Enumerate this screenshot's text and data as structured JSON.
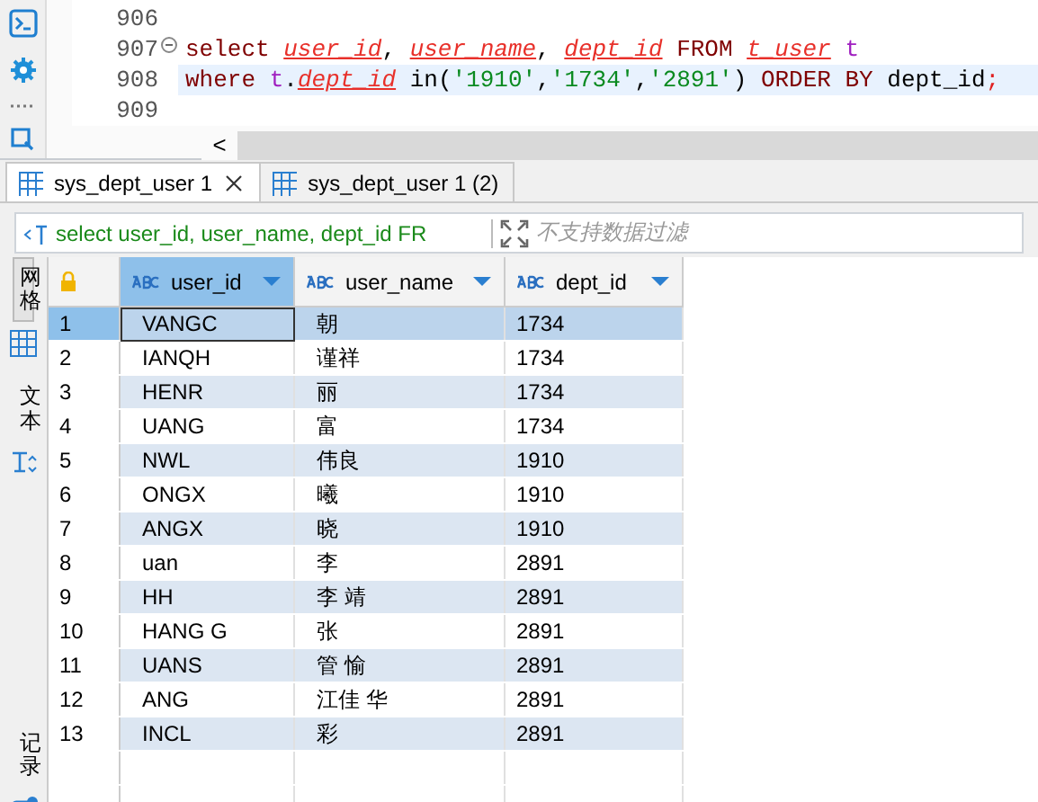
{
  "editor": {
    "lines": [
      {
        "number": "906",
        "current": false,
        "foldable": false
      },
      {
        "number": "907",
        "current": false,
        "foldable": true,
        "tokens": [
          {
            "text": "select ",
            "kind": "keyword"
          },
          {
            "text": "user_id",
            "kind": "error"
          },
          {
            "text": ", ",
            "kind": "plain"
          },
          {
            "text": "user_name",
            "kind": "error"
          },
          {
            "text": ", ",
            "kind": "plain"
          },
          {
            "text": "dept_id",
            "kind": "error"
          },
          {
            "text": " FROM ",
            "kind": "keyword"
          },
          {
            "text": "t_user",
            "kind": "error"
          },
          {
            "text": " t",
            "kind": "alias"
          }
        ]
      },
      {
        "number": "908",
        "current": true,
        "foldable": false,
        "tokens": [
          {
            "text": "where ",
            "kind": "keyword"
          },
          {
            "text": "t",
            "kind": "alias"
          },
          {
            "text": ".",
            "kind": "plain"
          },
          {
            "text": "dept_id",
            "kind": "error"
          },
          {
            "text": " in(",
            "kind": "plain"
          },
          {
            "text": "'1910'",
            "kind": "string"
          },
          {
            "text": ",",
            "kind": "plain"
          },
          {
            "text": "'1734'",
            "kind": "string"
          },
          {
            "text": ",",
            "kind": "plain"
          },
          {
            "text": "'2891'",
            "kind": "string"
          },
          {
            "text": ") ",
            "kind": "plain"
          },
          {
            "text": "ORDER BY ",
            "kind": "keyword"
          },
          {
            "text": "dept_id",
            "kind": "plain"
          },
          {
            "text": ";",
            "kind": "semicolon"
          }
        ]
      },
      {
        "number": "909",
        "current": false,
        "foldable": false
      }
    ],
    "scroll_left": "<"
  },
  "result_tabs": [
    {
      "label": "sys_dept_user 1",
      "selected": true,
      "closable": true
    },
    {
      "label": "sys_dept_user 1 (2)",
      "selected": false,
      "closable": false
    }
  ],
  "filter_bar": {
    "query": "select user_id, user_name, dept_id FR",
    "placeholder": "不支持数据过滤"
  },
  "side_tabs": [
    {
      "label": "网格",
      "kind": "grid",
      "selected": true
    },
    {
      "label": "文本",
      "kind": "text",
      "selected": false
    },
    {
      "label": "记录",
      "kind": "record",
      "selected": false
    }
  ],
  "table": {
    "columns": [
      {
        "label": "user_id",
        "selected": true
      },
      {
        "label": "user_name",
        "selected": false
      },
      {
        "label": "dept_id",
        "selected": false
      }
    ],
    "rows": [
      {
        "number": "1",
        "selected": true,
        "cells": [
          "VANGC",
          "朝",
          "1734"
        ]
      },
      {
        "number": "2",
        "selected": false,
        "cells": [
          "IANQH",
          "谨祥",
          "1734"
        ]
      },
      {
        "number": "3",
        "selected": false,
        "cells": [
          "HENR",
          "丽",
          "1734"
        ]
      },
      {
        "number": "4",
        "selected": false,
        "cells": [
          "UANG",
          "富",
          "1734"
        ]
      },
      {
        "number": "5",
        "selected": false,
        "cells": [
          "NWL",
          "伟良",
          "1910"
        ]
      },
      {
        "number": "6",
        "selected": false,
        "cells": [
          "ONGX",
          "曦",
          "1910"
        ]
      },
      {
        "number": "7",
        "selected": false,
        "cells": [
          "ANGX",
          "晓",
          "1910"
        ]
      },
      {
        "number": "8",
        "selected": false,
        "cells": [
          "uan",
          "李",
          "2891"
        ]
      },
      {
        "number": "9",
        "selected": false,
        "cells": [
          "HH",
          "李 靖",
          "2891"
        ]
      },
      {
        "number": "10",
        "selected": false,
        "cells": [
          "HANG G",
          "张",
          "2891"
        ]
      },
      {
        "number": "11",
        "selected": false,
        "cells": [
          "UANS",
          "管 愉",
          "2891"
        ]
      },
      {
        "number": "12",
        "selected": false,
        "cells": [
          "ANG",
          "江佳 华",
          "2891"
        ]
      },
      {
        "number": "13",
        "selected": false,
        "cells": [
          "INCL",
          "彩",
          "2891"
        ]
      }
    ]
  }
}
